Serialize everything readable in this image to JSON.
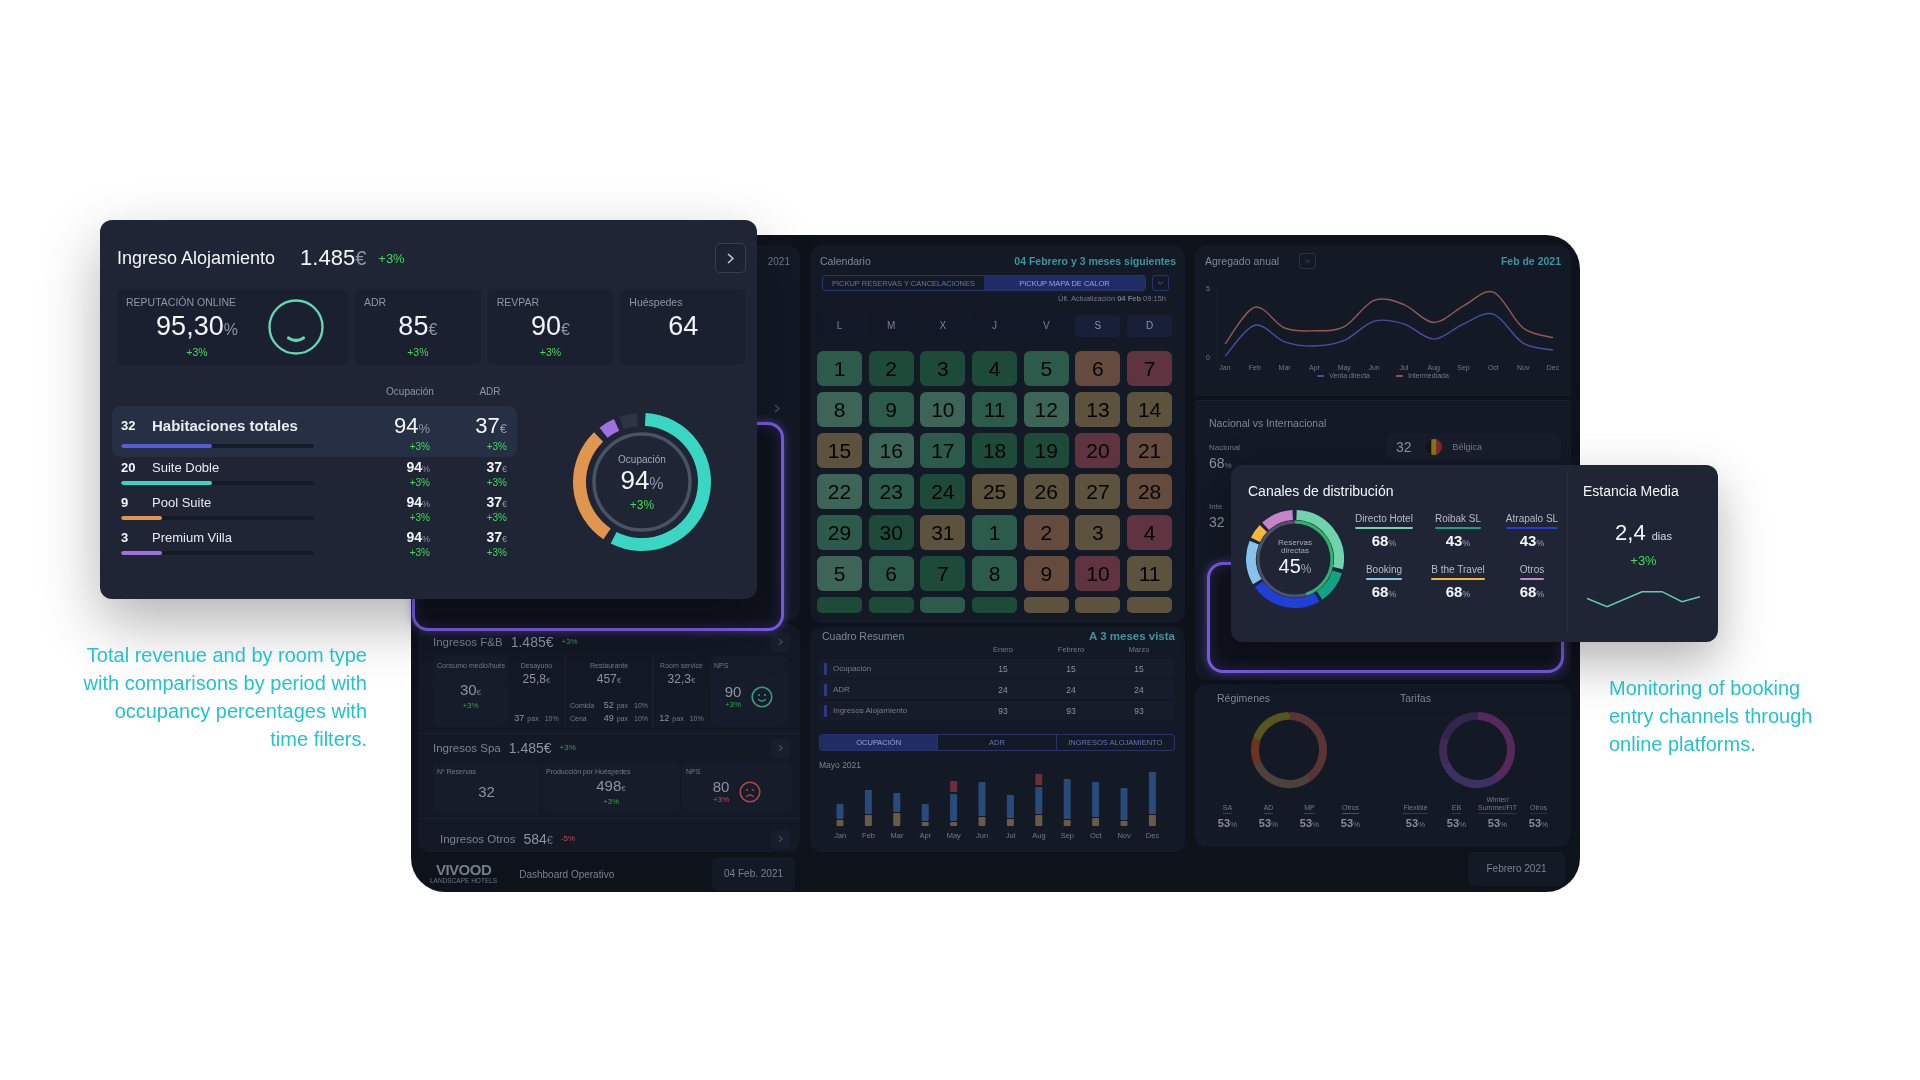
{
  "accommodation_card": {
    "title": "Ingreso Alojamiento",
    "amount": "1.485",
    "currency": "€",
    "change": "+3%",
    "kpis": [
      {
        "kind": "reputation",
        "label": "REPUTACIÓN ONLINE",
        "value": "95,30",
        "unit": "%",
        "change": "+3%"
      },
      {
        "kind": "metric",
        "label": "ADR",
        "value": "85",
        "unit": "€",
        "change": "+3%"
      },
      {
        "kind": "metric",
        "label": "REVPAR",
        "value": "90",
        "unit": "€",
        "change": "+3%"
      },
      {
        "kind": "metric",
        "label": "Huéspedes",
        "value": "64"
      }
    ],
    "columns": [
      "Ocupación",
      "ADR"
    ],
    "rooms": [
      {
        "count": "32",
        "name": "Habitaciones totales",
        "selected": true,
        "level": 0.47,
        "color": "#5a5bd6",
        "occupancy": "94",
        "occupancy_unit": "%",
        "occupancy_change": "+3%",
        "adr": "37",
        "adr_unit": "€",
        "adr_change": "+3%"
      },
      {
        "count": "20",
        "name": "Suite Doble",
        "selected": false,
        "level": 0.47,
        "color": "#3ad6c4",
        "occupancy": "94",
        "occupancy_unit": "%",
        "occupancy_change": "+3%",
        "adr": "37",
        "adr_unit": "€",
        "adr_change": "+3%"
      },
      {
        "count": "9",
        "name": "Pool Suite",
        "selected": false,
        "level": 0.21,
        "color": "#e0964f",
        "occupancy": "94",
        "occupancy_unit": "%",
        "occupancy_change": "+3%",
        "adr": "37",
        "adr_unit": "€",
        "adr_change": "+3%"
      },
      {
        "count": "3",
        "name": "Premium Villa",
        "selected": false,
        "level": 0.21,
        "color": "#a070e0",
        "occupancy": "94",
        "occupancy_unit": "%",
        "occupancy_change": "+3%",
        "adr": "37",
        "adr_unit": "€",
        "adr_change": "+3%"
      }
    ],
    "occupancy_donut": {
      "label": "Ocupación",
      "value": "94",
      "unit": "%",
      "change": "+3%"
    }
  },
  "dashboard": {
    "revenue_column": {
      "header_date": "2021",
      "sections": [
        {
          "title": "Ingresos F&B",
          "amount": "1.485€",
          "change": "+3%",
          "negative": false,
          "metrics": [
            {
              "kind": "single",
              "label": "Consumo medio/hués",
              "value": "30",
              "unit": "€",
              "change": "+3%",
              "negative": false
            },
            {
              "kind": "breakdown",
              "label": "Desayuno",
              "value": "25,8",
              "unit": "€",
              "rows": [
                {
                  "count": "37",
                  "count_unit": "pax",
                  "share": "10%"
                }
              ]
            },
            {
              "kind": "breakdown",
              "label": "Restaurante",
              "value": "457",
              "unit": "€",
              "rows": [
                {
                  "name": "Comida",
                  "count": "52",
                  "count_unit": "pax",
                  "share": "10%"
                },
                {
                  "name": "Cena",
                  "count": "49",
                  "count_unit": "pax",
                  "share": "10%"
                }
              ]
            },
            {
              "kind": "breakdown",
              "label": "Room service",
              "value": "32,3",
              "unit": "€",
              "rows": [
                {
                  "count": "12",
                  "count_unit": "pax",
                  "share": "10%"
                }
              ]
            },
            {
              "kind": "nps",
              "label": "NPS",
              "value": "90",
              "change": "+3%",
              "negative": false,
              "happy": true
            }
          ]
        },
        {
          "title": "Ingresos Spa",
          "amount": "1.485€",
          "change": "+3%",
          "negative": false,
          "metrics": [
            {
              "kind": "single",
              "label": "Nº Reservas",
              "value": "32"
            },
            {
              "kind": "single",
              "label": "Producción por Huéspedes",
              "value": "498",
              "unit": "€",
              "change": "+3%",
              "negative": false
            },
            {
              "kind": "nps",
              "label": "NPS",
              "value": "80",
              "change": "+3%",
              "negative": true,
              "happy": false
            }
          ]
        },
        {
          "title": "Ingresos Otros",
          "amount": "584",
          "unit": "€",
          "change": "-5%",
          "negative": true
        }
      ],
      "footer": {
        "logo": "VIVOOD",
        "logo_tagline": "LANDSCAPE HOTELS",
        "title": "Dashboard Operativo",
        "date": "04 Feb. 2021"
      }
    },
    "calendar": {
      "title": "Calendario",
      "range": "04 Febrero y 3 meses siguientes",
      "tabs": [
        {
          "label": "PICKUP RESERVAS Y CANCELACIONES",
          "selected": false
        },
        {
          "label": "PICKUP MAPA DE CALOR",
          "selected": true
        }
      ],
      "updated": "Últ. Actualización **04 Feb** 09:15h",
      "weekdays": [
        {
          "label": "L",
          "weekend": false
        },
        {
          "label": "M",
          "weekend": false
        },
        {
          "label": "X",
          "weekend": false
        },
        {
          "label": "J",
          "weekend": false
        },
        {
          "label": "V",
          "weekend": false
        },
        {
          "label": "S",
          "weekend": true
        },
        {
          "label": "D",
          "weekend": true
        }
      ],
      "cells": [
        {
          "day": "1",
          "color": "#2c5a4b"
        },
        {
          "day": "2",
          "color": "#1d4a39"
        },
        {
          "day": "3",
          "color": "#1d4a39"
        },
        {
          "day": "4",
          "color": "#1d4a39"
        },
        {
          "day": "5",
          "color": "#2c5a4b"
        },
        {
          "day": "6",
          "color": "#654a3e"
        },
        {
          "day": "7",
          "color": "#5f3440"
        },
        {
          "day": "8",
          "color": "#3c6558"
        },
        {
          "day": "9",
          "color": "#2c5a4b"
        },
        {
          "day": "10",
          "color": "#3c6558"
        },
        {
          "day": "11",
          "color": "#2c5a4b"
        },
        {
          "day": "12",
          "color": "#3c6558"
        },
        {
          "day": "13",
          "color": "#5d523d"
        },
        {
          "day": "14",
          "color": "#5d523d"
        },
        {
          "day": "15",
          "color": "#5d523d"
        },
        {
          "day": "16",
          "color": "#3c6558"
        },
        {
          "day": "17",
          "color": "#2c5a4b"
        },
        {
          "day": "18",
          "color": "#1d4a39"
        },
        {
          "day": "19",
          "color": "#1d4a39"
        },
        {
          "day": "20",
          "color": "#5f3440"
        },
        {
          "day": "21",
          "color": "#654a3e"
        },
        {
          "day": "22",
          "color": "#3c6558"
        },
        {
          "day": "23",
          "color": "#2c5a4b"
        },
        {
          "day": "24",
          "color": "#1d4a39"
        },
        {
          "day": "25",
          "color": "#5d523d"
        },
        {
          "day": "26",
          "color": "#5d523d"
        },
        {
          "day": "27",
          "color": "#5d523d"
        },
        {
          "day": "28",
          "color": "#654a3e"
        },
        {
          "day": "29",
          "color": "#2c5a4b"
        },
        {
          "day": "30",
          "color": "#1d4a39"
        },
        {
          "day": "31",
          "color": "#5d523d"
        },
        {
          "day": "1",
          "color": "#2c5a4b"
        },
        {
          "day": "2",
          "color": "#654a3e"
        },
        {
          "day": "3",
          "color": "#5d523d"
        },
        {
          "day": "4",
          "color": "#5f3440"
        },
        {
          "day": "5",
          "color": "#3c6558"
        },
        {
          "day": "6",
          "color": "#2c5a4b"
        },
        {
          "day": "7",
          "color": "#1d4a39"
        },
        {
          "day": "8",
          "color": "#2c5a4b"
        },
        {
          "day": "9",
          "color": "#654a3e"
        },
        {
          "day": "10",
          "color": "#5f3440"
        },
        {
          "day": "11",
          "color": "#5d523d"
        },
        {
          "color": "#1d4a39"
        },
        {
          "color": "#1d4a39"
        },
        {
          "color": "#2c5a4b"
        },
        {
          "color": "#1d4a39"
        },
        {
          "color": "#5d523d"
        },
        {
          "color": "#5d523d"
        },
        {
          "color": "#5d523d"
        }
      ]
    },
    "summary": {
      "title": "Cuadro Resumen",
      "range": "A 3 meses vista",
      "columns": [
        "Enero",
        "Febrero",
        "Marzo"
      ],
      "rows": [
        {
          "label": "Ocupación",
          "values": [
            "15",
            "15",
            "15"
          ]
        },
        {
          "label": "ADR",
          "values": [
            "24",
            "24",
            "24"
          ]
        },
        {
          "label": "Ingresos Alojamiento",
          "values": [
            "93",
            "93",
            "93"
          ]
        }
      ],
      "tabs": [
        {
          "label": "OCUPACIÓN",
          "selected": true
        },
        {
          "label": "ADR",
          "selected": false
        },
        {
          "label": "INGRESOS ALOJAMIENTO",
          "selected": false
        }
      ],
      "chart_title": "Mayo 2021",
      "months": [
        "Jan",
        "Feb",
        "Mar",
        "Apr",
        "May",
        "Jun",
        "Jul",
        "Aug",
        "Sep",
        "Oct",
        "Nov",
        "Dec"
      ]
    },
    "annual": {
      "title": "Agregado anual",
      "period": "Feb de 2021",
      "chart_data": {
        "type": "line",
        "categories": [
          "Jan",
          "Feb",
          "Mar",
          "Apr",
          "May",
          "Jun",
          "Jul",
          "Aug",
          "Sep",
          "Oct",
          "Nov",
          "Dec"
        ],
        "series": [
          {
            "name": "Venta directa",
            "color": "#4b4fa8",
            "values": [
              0.05,
              2.3,
              1.1,
              0.8,
              1.2,
              2.6,
              2.4,
              1.3,
              2.4,
              3.1,
              1.0,
              0.5
            ]
          },
          {
            "name": "Intermediada",
            "color": "#8f5b52",
            "values": [
              0.95,
              3.6,
              2.1,
              1.9,
              2.2,
              4.1,
              3.8,
              2.5,
              3.7,
              4.7,
              2.1,
              1.4
            ]
          }
        ],
        "ylim": [
          0,
          5
        ],
        "yticks": [
          0,
          5
        ]
      }
    },
    "nationality": {
      "title": "Nacional vs Internacional",
      "groups": [
        {
          "label": "Nacional",
          "value": "68",
          "unit": "%"
        },
        {
          "label": "Inte",
          "value": "32"
        }
      ],
      "countries": [
        {
          "count": "32",
          "name": "Bélgica"
        }
      ]
    },
    "mix": {
      "groups": [
        {
          "title": "Régimenes",
          "items": [
            {
              "label": "SA",
              "value": "53",
              "unit": "%",
              "color": "#5a3434"
            },
            {
              "label": "AD",
              "value": "53",
              "unit": "%",
              "color": "#4d413c"
            },
            {
              "label": "MP",
              "value": "53",
              "unit": "%",
              "color": "#6a3520"
            },
            {
              "label": "Otros",
              "value": "53",
              "unit": "%",
              "color": "#57561f"
            }
          ]
        },
        {
          "title": "Tarifas",
          "items": [
            {
              "label": "Flexible",
              "value": "53",
              "unit": "%",
              "color": "#56295b"
            },
            {
              "label": "EB",
              "value": "53",
              "unit": "%",
              "color": "#3e3062"
            },
            {
              "label": "Winter/ Summer/FIT",
              "value": "53",
              "unit": "%",
              "color": "#3f2a55"
            },
            {
              "label": "Otros",
              "value": "53",
              "unit": "%",
              "color": "#33264d"
            }
          ]
        }
      ]
    },
    "period_footer": {
      "date": "Febrero 2021"
    }
  },
  "channels_card": {
    "distribution": {
      "title": "Canales de distribución",
      "direct_share": {
        "label": "Reservas directas",
        "value": "45",
        "unit": "%",
        "level": 0.45
      },
      "channels": [
        {
          "name": "Directo Hotel",
          "value": "68",
          "unit": "%",
          "color": "#6fd3ac"
        },
        {
          "name": "Roibak SL",
          "value": "43",
          "unit": "%",
          "color": "#12a386"
        },
        {
          "name": "Atrapalo SL",
          "value": "43",
          "unit": "%",
          "color": "#1f3fd6"
        },
        {
          "name": "Booking",
          "value": "68",
          "unit": "%",
          "color": "#86c3ea"
        },
        {
          "name": "B the Travel",
          "value": "68",
          "unit": "%",
          "color": "#f4b73c"
        },
        {
          "name": "Otros",
          "value": "68",
          "unit": "%",
          "color": "#c784c9"
        }
      ]
    },
    "average_stay": {
      "title": "Estancia Media",
      "value": "2,4",
      "unit": "dias",
      "change": "+3%"
    }
  },
  "captions": {
    "card_note": {
      "lines": [
        "Total revenue and by room type",
        "with comparisons by period with",
        "occupancy percentages with",
        "time filters."
      ]
    },
    "channels_note": {
      "lines": [
        "Monitoring of booking",
        "entry channels through",
        "online platforms."
      ]
    }
  }
}
